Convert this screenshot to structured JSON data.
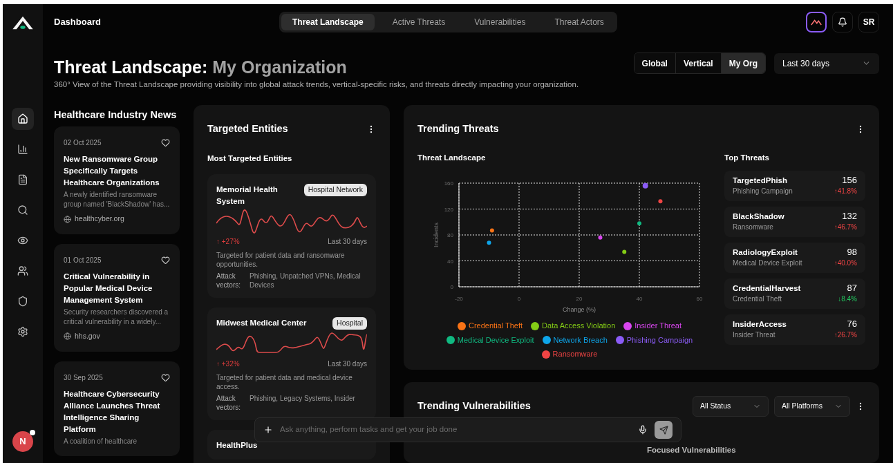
{
  "brand": {
    "label": "Dashboard"
  },
  "nav_tabs": [
    {
      "label": "Threat Landscape",
      "selected": true
    },
    {
      "label": "Active Threats",
      "selected": false
    },
    {
      "label": "Vulnerabilities",
      "selected": false
    },
    {
      "label": "Threat Actors",
      "selected": false
    }
  ],
  "user": {
    "initials": "SR"
  },
  "sidebar": {
    "items": [
      {
        "selected": true
      },
      {
        "selected": false
      },
      {
        "selected": false
      },
      {
        "selected": false
      },
      {
        "selected": false
      },
      {
        "selected": false
      },
      {
        "selected": false
      },
      {
        "selected": false
      }
    ],
    "avatar": "N"
  },
  "page": {
    "title": "Threat Landscape:",
    "title_accent": "My Organization",
    "subtitle": "360° View of the Threat Landscape providing visibility into global attack trends, vertical-specific risks, and threats directly impacting your organization."
  },
  "scope": [
    {
      "label": "Global",
      "selected": false
    },
    {
      "label": "Vertical",
      "selected": false
    },
    {
      "label": "My Org",
      "selected": true
    }
  ],
  "period": {
    "value": "Last 30 days"
  },
  "news": {
    "title": "Healthcare Industry News",
    "items": [
      {
        "date": "02 Oct 2025",
        "headline": "New Ransomware Group Specifically Targets Healthcare Organizations",
        "summary": "A newly identified ransomware group named 'BlackShadow' has...",
        "source": "healthcyber.org"
      },
      {
        "date": "01 Oct 2025",
        "headline": "Critical Vulnerability in Popular Medical Device Management System",
        "summary": "Security researchers discovered a critical vulnerability in a widely...",
        "source": "hhs.gov"
      },
      {
        "date": "30 Sep 2025",
        "headline": "Healthcare Cybersecurity Alliance Launches Threat Intelligence Sharing Platform",
        "summary": "A coalition of healthcare"
      }
    ]
  },
  "entities": {
    "title": "Targeted Entities",
    "subtitle": "Most Targeted Entities",
    "items": [
      {
        "name": "Memorial Health System",
        "tag": "Hospital Network",
        "change": "↑ +27%",
        "period": "Last 30 days",
        "description": "Targeted for patient data and ransomware opportunities.",
        "vectors_label": "Attack vectors:",
        "vectors": "Phishing, Unpatched VPNs, Medical Devices"
      },
      {
        "name": "Midwest Medical Center",
        "tag": "Hospital",
        "change": "↑ +32%",
        "period": "Last 30 days",
        "description": "Targeted for patient data and medical device access.",
        "vectors_label": "Attack vectors:",
        "vectors": "Phishing, Legacy Systems, Insider"
      },
      {
        "name": "HealthPlus"
      }
    ]
  },
  "trending": {
    "title": "Trending Threats",
    "chart_title": "Threat Landscape",
    "chart_data": {
      "type": "scatter",
      "grid": true,
      "legend": "bottom",
      "xlabel": "Change (%)",
      "ylabel": "Incidents",
      "xlim": [
        -20,
        60
      ],
      "ylim": [
        0,
        160
      ],
      "xticks": [
        -20,
        0,
        20,
        40,
        60
      ],
      "yticks": [
        0,
        40,
        80,
        120,
        160
      ],
      "series": [
        {
          "name": "Credential Theft",
          "color": "#f97316",
          "x": [
            -9
          ],
          "values": [
            87
          ]
        },
        {
          "name": "Data Access Violation",
          "color": "#84cc16",
          "x": [
            35
          ],
          "values": [
            54
          ]
        },
        {
          "name": "Insider Threat",
          "color": "#d946ef",
          "x": [
            27
          ],
          "values": [
            76
          ]
        },
        {
          "name": "Medical Device Exploit",
          "color": "#10b981",
          "x": [
            40
          ],
          "values": [
            98
          ]
        },
        {
          "name": "Network Breach",
          "color": "#0ea5e9",
          "x": [
            -10
          ],
          "values": [
            68
          ]
        },
        {
          "name": "Phishing Campaign",
          "color": "#8b5cf6",
          "x": [
            42
          ],
          "values": [
            156
          ]
        },
        {
          "name": "Ransomware",
          "color": "#ef4444",
          "x": [
            47
          ],
          "values": [
            132
          ]
        }
      ]
    },
    "top_title": "Top Threats",
    "top": [
      {
        "name": "TargetedPhish",
        "category": "Phishing Campaign",
        "count": "156",
        "change": "↑41.8%",
        "rising": true
      },
      {
        "name": "BlackShadow",
        "category": "Ransomware",
        "count": "132",
        "change": "↑46.7%",
        "rising": true
      },
      {
        "name": "RadiologyExploit",
        "category": "Medical Device Exploit",
        "count": "98",
        "change": "↑40.0%",
        "rising": true
      },
      {
        "name": "CredentialHarvest",
        "category": "Credential Theft",
        "count": "87",
        "change": "↓8.4%",
        "rising": false
      },
      {
        "name": "InsiderAccess",
        "category": "Insider Threat",
        "count": "76",
        "change": "↑26.7%",
        "rising": true
      }
    ]
  },
  "vulnerabilities": {
    "title": "Trending Vulnerabilities",
    "filters": [
      "All Status",
      "All Platforms"
    ],
    "right_title": "Focused Vulnerabilities"
  },
  "chat": {
    "placeholder": "Ask anything, perform tasks and get your job done"
  }
}
